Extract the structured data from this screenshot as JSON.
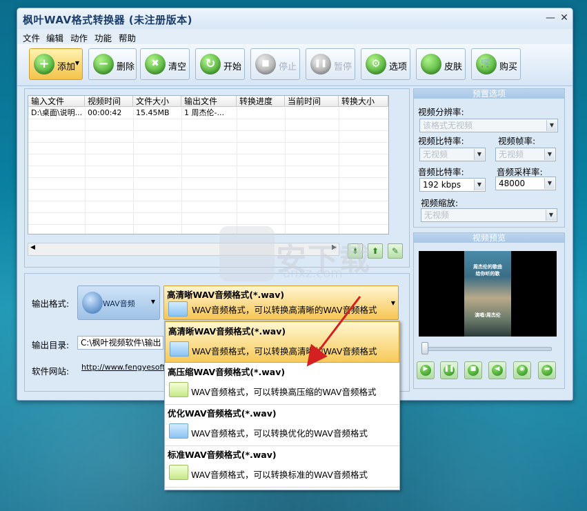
{
  "window": {
    "title": "枫叶WAV格式转换器  (未注册版本)",
    "minimize": "—",
    "close": "✕"
  },
  "menu": [
    "文件",
    "编辑",
    "动作",
    "功能",
    "帮助"
  ],
  "toolbar": {
    "buttons": [
      {
        "label": "添加",
        "icon": "plus-icon",
        "glyph": "+",
        "state": "active",
        "has_dropdown": true
      },
      {
        "label": "删除",
        "icon": "minus-icon",
        "glyph": "−",
        "state": "normal"
      },
      {
        "label": "清空",
        "icon": "clear-icon",
        "glyph": "✖",
        "state": "normal"
      },
      {
        "label": "开始",
        "icon": "refresh-icon",
        "glyph": "↻",
        "state": "normal"
      },
      {
        "label": "停止",
        "icon": "stop-icon",
        "glyph": "■",
        "state": "disabled"
      },
      {
        "label": "暂停",
        "icon": "pause-icon",
        "glyph": "❚❚",
        "state": "disabled"
      },
      {
        "label": "选项",
        "icon": "options-icon",
        "glyph": "⚙",
        "state": "normal"
      },
      {
        "label": "皮肤",
        "icon": "skin-icon",
        "glyph": "",
        "state": "normal"
      },
      {
        "label": "购买",
        "icon": "cart-icon",
        "glyph": "🛒",
        "state": "normal"
      }
    ]
  },
  "file_table": {
    "columns": [
      "输入文件",
      "视频时间",
      "文件大小",
      "输出文件",
      "转换进度",
      "当前时间",
      "转换大小"
    ],
    "rows": [
      [
        "D:\\桌面\\说明...",
        "00:00:42",
        "15.45MB",
        "1 周杰伦-...",
        "",
        "",
        ""
      ]
    ]
  },
  "output": {
    "format_label": "输出格式:",
    "format_value": "WAV音频",
    "dir_label": "输出目录:",
    "dir_value": "C:\\枫叶视频软件\\输出",
    "site_label": "软件网站:",
    "site_value": "http://www.fengyesoft.c"
  },
  "profile": {
    "name": "高清晰WAV音频格式(*.wav)",
    "desc": "WAV音频格式，可以转换高清晰的WAV音频格式"
  },
  "profile_options": [
    {
      "name": "高清晰WAV音频格式(*.wav)",
      "desc": "WAV音频格式，可以转换高清晰的WAV音频格式",
      "selected": true,
      "icon": "blue"
    },
    {
      "name": "高压缩WAV音频格式(*.wav)",
      "desc": "WAV音频格式，可以转换高压缩的WAV音频格式",
      "selected": false,
      "icon": "green"
    },
    {
      "name": "优化WAV音频格式(*.wav)",
      "desc": "WAV音频格式，可以转换优化的WAV音频格式",
      "selected": false,
      "icon": "blue"
    },
    {
      "name": "标准WAV音频格式(*.wav)",
      "desc": "WAV音频格式，可以转换标准的WAV音频格式",
      "selected": false,
      "icon": "green"
    }
  ],
  "preset": {
    "title": "预置选项",
    "video_resolution_label": "视频分辨率:",
    "video_resolution": "该格式无视频",
    "video_bitrate_label": "视频比特率:",
    "video_bitrate": "无视频",
    "video_fps_label": "视频帧率:",
    "video_fps": "无视频",
    "audio_bitrate_label": "音频比特率:",
    "audio_bitrate": "192 kbps",
    "audio_samplerate_label": "音频采样率:",
    "audio_samplerate": "48000",
    "video_scale_label": "视频缩放:",
    "video_scale": "无视频"
  },
  "preview": {
    "title": "视频预览",
    "overlay_lines": [
      "周杰伦的歌曲",
      "给你听的歌",
      "",
      "演唱:周杰伦"
    ]
  },
  "watermark": {
    "text": "安下载",
    "sub": "anxz.com"
  },
  "colors": {
    "accent": "#f7c654",
    "arrow": "#d42020"
  }
}
